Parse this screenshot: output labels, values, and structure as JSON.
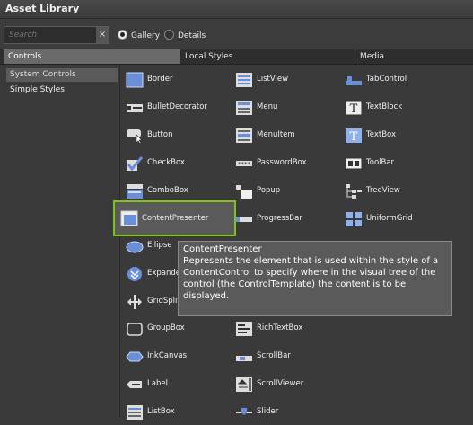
{
  "title": "Asset Library",
  "search": {
    "placeholder": "Search",
    "clear": "×"
  },
  "view": {
    "gallery": "Gallery",
    "details": "Details",
    "selected": "Gallery"
  },
  "tabs": [
    {
      "label": "Controls"
    },
    {
      "label": "Local Styles"
    },
    {
      "label": "Media"
    }
  ],
  "sidebar": [
    {
      "label": "System Controls",
      "selected": true
    },
    {
      "label": "Simple Styles",
      "selected": false
    }
  ],
  "controls": [
    {
      "label": "Border",
      "icon": "border-icon"
    },
    {
      "label": "ListView",
      "icon": "listview-icon"
    },
    {
      "label": "TabControl",
      "icon": "tabcontrol-icon"
    },
    {
      "label": "BulletDecorator",
      "icon": "bulletdecorator-icon"
    },
    {
      "label": "Menu",
      "icon": "menu-icon"
    },
    {
      "label": "TextBlock",
      "icon": "textblock-icon"
    },
    {
      "label": "Button",
      "icon": "button-icon"
    },
    {
      "label": "MenuItem",
      "icon": "menuitem-icon"
    },
    {
      "label": "TextBox",
      "icon": "textbox-icon"
    },
    {
      "label": "CheckBox",
      "icon": "checkbox-icon"
    },
    {
      "label": "PasswordBox",
      "icon": "passwordbox-icon"
    },
    {
      "label": "ToolBar",
      "icon": "toolbar-icon"
    },
    {
      "label": "ComboBox",
      "icon": "combobox-icon"
    },
    {
      "label": "Popup",
      "icon": "popup-icon"
    },
    {
      "label": "TreeView",
      "icon": "treeview-icon"
    },
    {
      "label": "ContentPresenter",
      "icon": "contentpresenter-icon",
      "selected": true
    },
    {
      "label": "ProgressBar",
      "icon": "progressbar-icon"
    },
    {
      "label": "UniformGrid",
      "icon": "uniformgrid-icon"
    },
    {
      "label": "Ellipse",
      "icon": "ellipse-icon"
    },
    {
      "label": "",
      "icon": ""
    },
    {
      "label": "",
      "icon": ""
    },
    {
      "label": "Expande",
      "icon": "expander-icon"
    },
    {
      "label": "",
      "icon": ""
    },
    {
      "label": "",
      "icon": ""
    },
    {
      "label": "GridSplit",
      "icon": "gridsplitter-icon"
    },
    {
      "label": "",
      "icon": ""
    },
    {
      "label": "",
      "icon": ""
    },
    {
      "label": "GroupBox",
      "icon": "groupbox-icon"
    },
    {
      "label": "RichTextBox",
      "icon": "richtextbox-icon"
    },
    {
      "label": "",
      "icon": ""
    },
    {
      "label": "InkCanvas",
      "icon": "inkcanvas-icon"
    },
    {
      "label": "ScrollBar",
      "icon": "scrollbar-icon"
    },
    {
      "label": "",
      "icon": ""
    },
    {
      "label": "Label",
      "icon": "label-icon"
    },
    {
      "label": "ScrollViewer",
      "icon": "scrollviewer-icon"
    },
    {
      "label": "",
      "icon": ""
    },
    {
      "label": "ListBox",
      "icon": "listbox-icon"
    },
    {
      "label": "Slider",
      "icon": "slider-icon"
    },
    {
      "label": "",
      "icon": ""
    }
  ],
  "tooltip": {
    "title": "ContentPresenter",
    "description": "Represents the element that is used within the style of a ContentControl to specify where in the visual tree of the control (the ControlTemplate) the content is to be displayed."
  },
  "colors": {
    "accent": "#7fc31a",
    "icon_blue": "#6a8fd8"
  }
}
